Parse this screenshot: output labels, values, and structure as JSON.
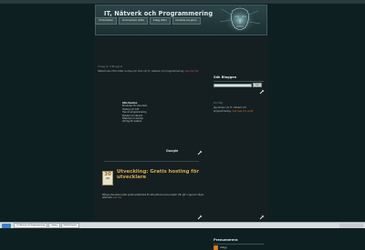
{
  "site": {
    "title": "IT, Nätverk och Programmering",
    "nav": [
      "Till startsidan",
      "Kommentarer (RSS)",
      "Inlägg (RSS)",
      "Kontakta oss gärna"
    ]
  },
  "main": {
    "notice_label": "Inlägg av IT-Bloggare",
    "notice_text": "Välkommen! Här hittar du tips och trick om IT, nätverk och programmering.",
    "notice_link": "Läs mer här",
    "linkbox": {
      "heading": "Gilla Kanalen",
      "lines": [
        "Bra länkar för utvecklare",
        "Hosting och drift",
        "Tips om programmering",
        "Nyheter om nätverk",
        "Säkerhet och backup",
        "Verktyg för webben"
      ],
      "brand": "Google"
    },
    "post": {
      "date_day": "30",
      "date_month": "JAN",
      "title": "Utveckling: Gratis hosting för utvecklare",
      "body": "Många utvecklare söker gratis webbhotell för att publicera sina projekt. Här går vi igenom några alternativ.",
      "link": "Läs mer"
    }
  },
  "sidebar": {
    "search_title": "Sök Bloggen",
    "search_button": "Sök",
    "about_label": "Om Mig",
    "about_text": "Jag skriver om IT, nätverk och programmering.",
    "about_link": "Visa hela min profil",
    "subscribe_title": "Prenumerera",
    "rss_label": "Inlägg"
  },
  "taskbar": {
    "items": [
      "IT, Nätverk och Programmering",
      "Inkorg",
      "Mozilla Firefox"
    ]
  }
}
